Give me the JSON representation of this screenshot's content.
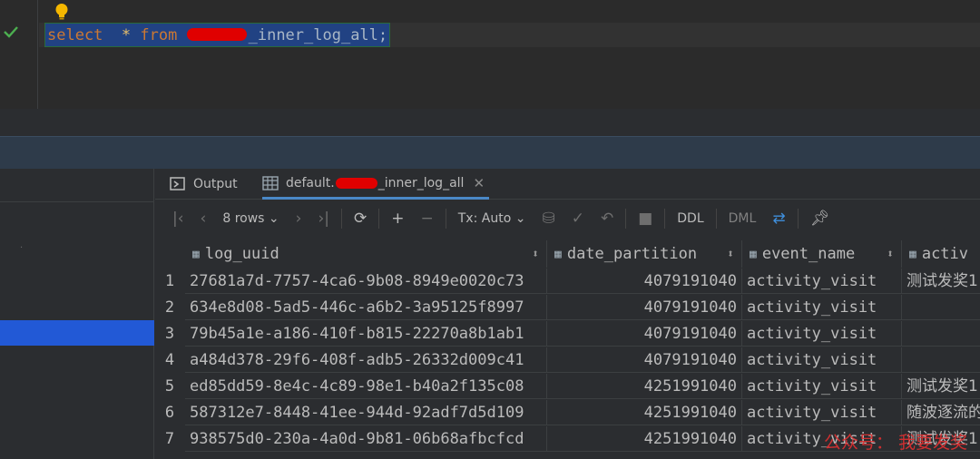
{
  "editor": {
    "keyword_select": "select",
    "star": "*",
    "keyword_from": "from",
    "table_suffix": "_inner_log_all",
    "terminator": ";"
  },
  "results": {
    "tabs": {
      "output_label": "Output",
      "table_prefix": "default.",
      "table_suffix": "_inner_log_all"
    },
    "toolbar": {
      "rows_label": "8 rows",
      "tx_label": "Tx: Auto",
      "ddl_label": "DDL",
      "dml_label": "DML"
    },
    "columns": [
      "log_uuid",
      "date_partition",
      "event_name",
      "activ"
    ],
    "rows": [
      {
        "n": "1",
        "log_uuid": "27681a7d-7757-4ca6-9b08-8949e0020c73",
        "date_partition": "4079191040",
        "event_name": "activity_visit",
        "activ": "测试发奖1"
      },
      {
        "n": "2",
        "log_uuid": "634e8d08-5ad5-446c-a6b2-3a95125f8997",
        "date_partition": "4079191040",
        "event_name": "activity_visit",
        "activ": ""
      },
      {
        "n": "3",
        "log_uuid": "79b45a1e-a186-410f-b815-22270a8b1ab1",
        "date_partition": "4079191040",
        "event_name": "activity_visit",
        "activ": ""
      },
      {
        "n": "4",
        "log_uuid": "a484d378-29f6-408f-adb5-26332d009c41",
        "date_partition": "4079191040",
        "event_name": "activity_visit",
        "activ": ""
      },
      {
        "n": "5",
        "log_uuid": "ed85dd59-8e4c-4c89-98e1-b40a2f135c08",
        "date_partition": "4251991040",
        "event_name": "activity_visit",
        "activ": "测试发奖1"
      },
      {
        "n": "6",
        "log_uuid": "587312e7-8448-41ee-944d-92adf7d5d109",
        "date_partition": "4251991040",
        "event_name": "activity_visit",
        "activ": "随波逐流的"
      },
      {
        "n": "7",
        "log_uuid": "938575d0-230a-4a0d-9b81-06b68afbcfcd",
        "date_partition": "4251991040",
        "event_name": "activity_visit",
        "activ": "测试发奖1"
      }
    ]
  },
  "watermark": "公众号：  我要发奖"
}
